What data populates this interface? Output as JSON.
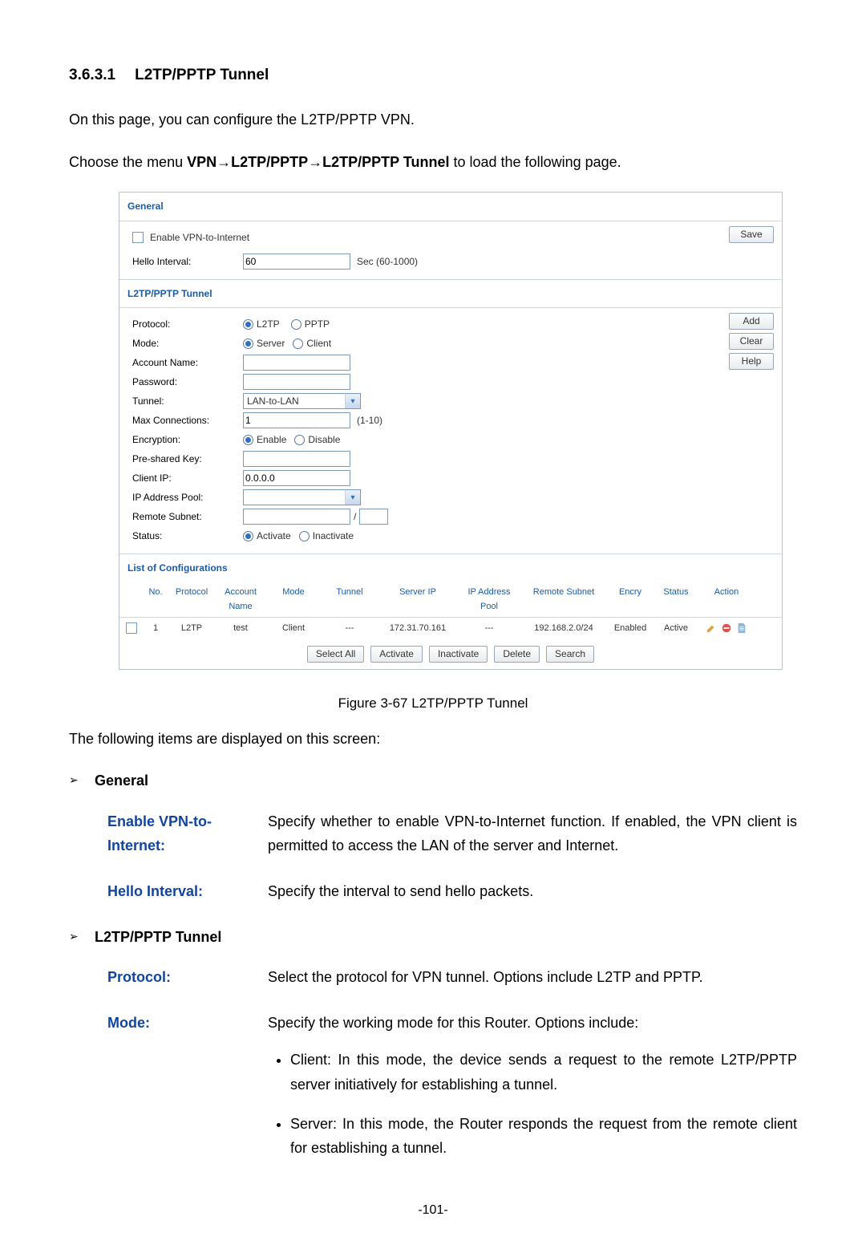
{
  "heading": {
    "number": "3.6.3.1",
    "title": "L2TP/PPTP Tunnel"
  },
  "intro1": "On this page, you can configure the L2TP/PPTP VPN.",
  "intro2_pre": "Choose the menu ",
  "intro2_bold": "VPN→L2TP/PPTP→L2TP/PPTP Tunnel",
  "intro2_post": " to load the following page.",
  "shot": {
    "general": {
      "title": "General",
      "enable_label": "Enable VPN-to-Internet",
      "hello_label": "Hello Interval:",
      "hello_value": "60",
      "hello_unit": "Sec (60-1000)",
      "save": "Save"
    },
    "tunnel": {
      "title": "L2TP/PPTP Tunnel",
      "protocol_label": "Protocol:",
      "protocol_l2tp": "L2TP",
      "protocol_pptp": "PPTP",
      "mode_label": "Mode:",
      "mode_server": "Server",
      "mode_client": "Client",
      "acct_label": "Account Name:",
      "pwd_label": "Password:",
      "tunnel_label": "Tunnel:",
      "tunnel_value": "LAN-to-LAN",
      "maxconn_label": "Max Connections:",
      "maxconn_value": "1",
      "maxconn_range": "(1-10)",
      "enc_label": "Encryption:",
      "enc_enable": "Enable",
      "enc_disable": "Disable",
      "psk_label": "Pre-shared Key:",
      "clientip_label": "Client IP:",
      "clientip_value": "0.0.0.0",
      "pool_label": "IP Address Pool:",
      "rsub_label": "Remote Subnet:",
      "rsub_sep": "/",
      "status_label": "Status:",
      "status_act": "Activate",
      "status_inact": "Inactivate",
      "btn_add": "Add",
      "btn_clear": "Clear",
      "btn_help": "Help"
    },
    "cfg": {
      "title": "List of Configurations",
      "head": {
        "no": "No.",
        "proto": "Protocol",
        "acct": "Account Name",
        "mode": "Mode",
        "tunnel": "Tunnel",
        "server": "Server IP",
        "pool": "IP Address Pool",
        "rsub": "Remote Subnet",
        "encry": "Encry",
        "status": "Status",
        "action": "Action"
      },
      "row": {
        "no": "1",
        "proto": "L2TP",
        "acct": "test",
        "mode": "Client",
        "tunnel": "---",
        "server": "172.31.70.161",
        "pool": "---",
        "rsub": "192.168.2.0/24",
        "encry": "Enabled",
        "status": "Active"
      },
      "btns": {
        "selall": "Select All",
        "act": "Activate",
        "inact": "Inactivate",
        "del": "Delete",
        "search": "Search"
      }
    }
  },
  "caption": "Figure 3-67 L2TP/PPTP Tunnel",
  "following": "The following items are displayed on this screen:",
  "sec_general": "General",
  "def1": {
    "label": "Enable VPN-to-Internet:",
    "text": "Specify whether to enable VPN-to-Internet function. If enabled, the VPN client is permitted to access the LAN of the server and Internet."
  },
  "def2": {
    "label": "Hello Interval:",
    "text": "Specify the interval to send hello packets."
  },
  "sec_tunnel": "L2TP/PPTP Tunnel",
  "def3": {
    "label": "Protocol:",
    "text": "Select the protocol for VPN tunnel. Options include L2TP and PPTP."
  },
  "def4": {
    "label": "Mode:",
    "text": "Specify the working mode for this Router. Options include:"
  },
  "mode_bullets": [
    "Client: In this mode, the device sends a request to the remote L2TP/PPTP server initiatively for establishing a tunnel.",
    "Server: In this mode, the Router responds the request from the remote client for establishing a tunnel."
  ],
  "page_number": "-101-"
}
